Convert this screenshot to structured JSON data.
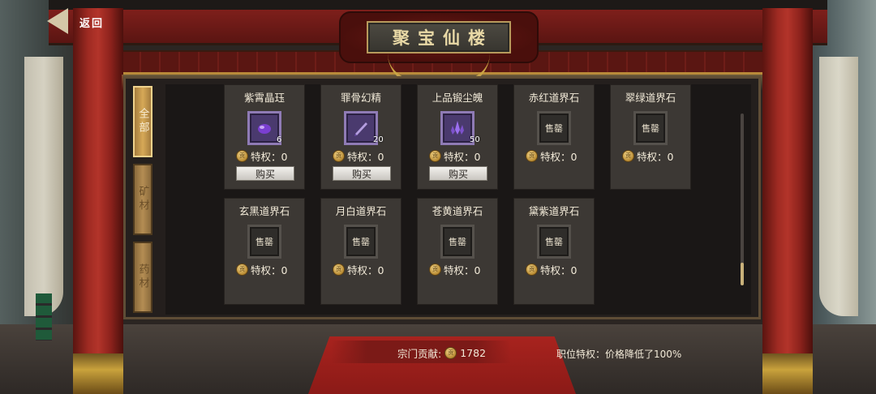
{
  "header": {
    "back_label": "返回",
    "title": "聚宝仙楼"
  },
  "categories": [
    {
      "label": "全部",
      "active": true
    },
    {
      "label": "矿材",
      "active": false
    },
    {
      "label": "药材",
      "active": false
    }
  ],
  "items": [
    {
      "name": "紫霄晶珏",
      "icon": "purple-orb-icon",
      "count": "6",
      "privilege": "特权：0",
      "buy_label": "购买"
    },
    {
      "name": "罪骨幻精",
      "icon": "purple-blade-icon",
      "count": "20",
      "privilege": "特权：0",
      "buy_label": "购买"
    },
    {
      "name": "上品锻尘魄",
      "icon": "purple-crystal-icon",
      "count": "50",
      "privilege": "特权：0",
      "buy_label": "购买"
    },
    {
      "name": "赤红道界石",
      "icon": "stone-icon",
      "sold_out": "售罄",
      "privilege": "特权：0"
    },
    {
      "name": "翠绿道界石",
      "icon": "stone-icon",
      "sold_out": "售罄",
      "privilege": "特权：0"
    },
    {
      "name": "玄黑道界石",
      "icon": "stone-icon",
      "sold_out": "售罄",
      "privilege": "特权：0"
    },
    {
      "name": "月白道界石",
      "icon": "stone-icon",
      "sold_out": "售罄",
      "privilege": "特权：0"
    },
    {
      "name": "苍黄道界石",
      "icon": "stone-icon",
      "sold_out": "售罄",
      "privilege": "特权：0"
    },
    {
      "name": "黛紫道界石",
      "icon": "stone-icon",
      "sold_out": "售罄",
      "privilege": "特权：0"
    }
  ],
  "coin_glyph": "贡",
  "footer": {
    "contribution_label": "宗门贡献:",
    "contribution_value": "1782",
    "rank_privilege": "职位特权：价格降低了100%"
  },
  "colors": {
    "pillar_red": "#9e2a22",
    "gold_accent": "#c9a443",
    "card_bg": "#3c3834"
  }
}
